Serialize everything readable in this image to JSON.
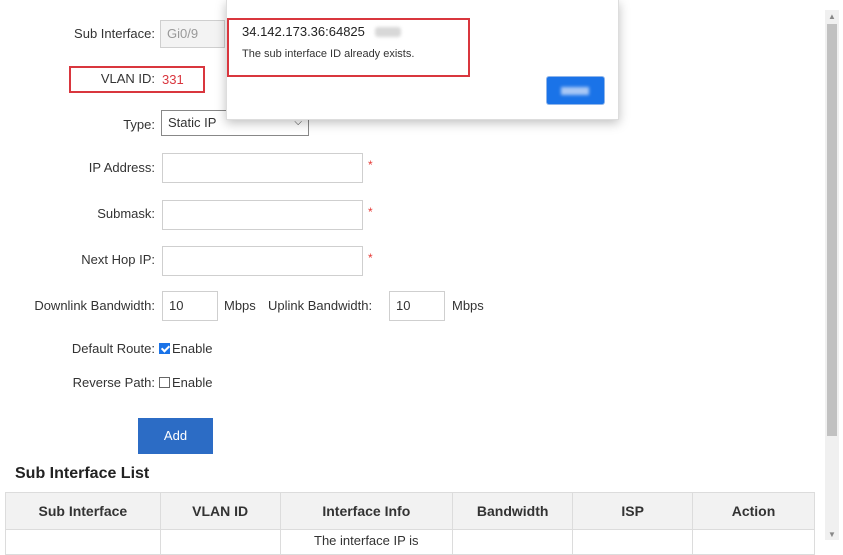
{
  "form": {
    "sub_interface_label": "Sub Interface:",
    "sub_interface_value": "Gi0/9",
    "vlan_label": "VLAN ID:",
    "vlan_value": "331",
    "type_label": "Type:",
    "type_value": "Static IP",
    "ip_label": "IP Address:",
    "ip_value": "",
    "submask_label": "Submask:",
    "submask_value": "",
    "nexthop_label": "Next Hop IP:",
    "nexthop_value": "",
    "required_mark": "*",
    "downlink_label": "Downlink Bandwidth:",
    "downlink_value": "10",
    "downlink_unit": "Mbps",
    "uplink_label": "Uplink Bandwidth:",
    "uplink_value": "10",
    "uplink_unit": "Mbps",
    "default_route_label": "Default Route:",
    "default_route_option": "Enable",
    "default_route_checked": true,
    "reverse_path_label": "Reverse Path:",
    "reverse_path_option": "Enable",
    "reverse_path_checked": false,
    "add_button": "Add"
  },
  "list": {
    "title": "Sub Interface List",
    "columns": [
      "Sub Interface",
      "VLAN ID",
      "Interface Info",
      "Bandwidth",
      "ISP",
      "Action"
    ],
    "partial_row": {
      "interface_info": "The interface IP is"
    }
  },
  "dialog": {
    "source": "34.142.173.36:64825",
    "message": "The sub interface ID already exists."
  },
  "colors": {
    "accent": "#2c6cc5",
    "highlight": "#d9363e",
    "required": "#e53935",
    "vlan_text": "#d9363e"
  }
}
